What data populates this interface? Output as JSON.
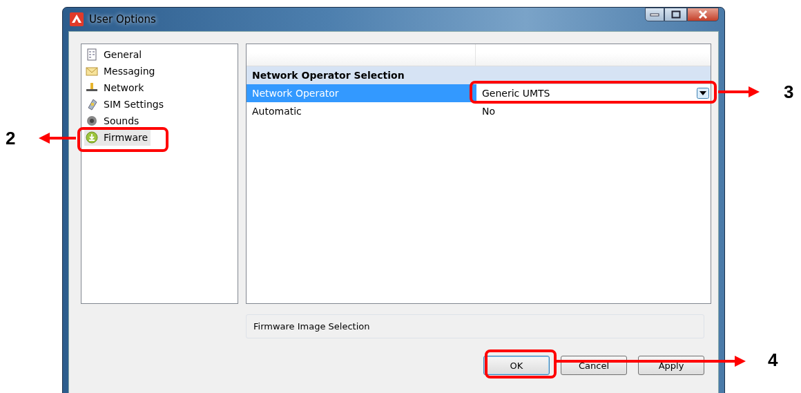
{
  "window": {
    "title": "User Options"
  },
  "sidebar": {
    "items": [
      {
        "label": "General",
        "selected": false
      },
      {
        "label": "Messaging",
        "selected": false
      },
      {
        "label": "Network",
        "selected": false
      },
      {
        "label": "SIM Settings",
        "selected": false
      },
      {
        "label": "Sounds",
        "selected": false
      },
      {
        "label": "Firmware",
        "selected": true
      }
    ]
  },
  "property_grid": {
    "category": "Network Operator Selection",
    "rows": [
      {
        "name": "Network Operator",
        "value": "Generic UMTS",
        "kind": "dropdown",
        "selected": true
      },
      {
        "name": "Automatic",
        "value": "No",
        "kind": "text",
        "selected": false
      }
    ]
  },
  "description": "Firmware Image Selection",
  "buttons": [
    {
      "label": "OK",
      "default": true
    },
    {
      "label": "Cancel",
      "default": false
    },
    {
      "label": "Apply",
      "default": false
    }
  ],
  "callouts": [
    {
      "number": "2"
    },
    {
      "number": "3"
    },
    {
      "number": "4"
    }
  ]
}
